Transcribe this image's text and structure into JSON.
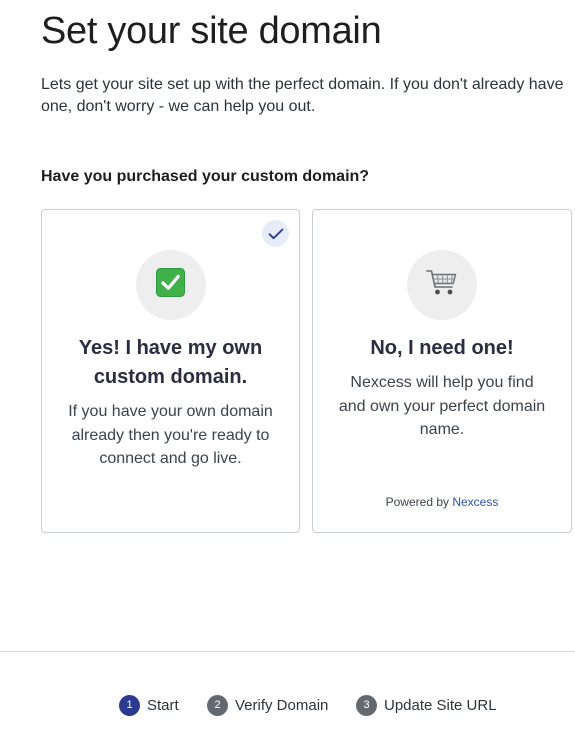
{
  "header": {
    "title": "Set your site domain",
    "intro": "Lets get your site set up with the perfect domain. If you don't already have one, don't worry - we can help you out."
  },
  "question": "Have you purchased your custom domain?",
  "options": [
    {
      "title": "Yes! I have my own custom domain.",
      "description": "If you have your own domain already then you're ready to connect and go live.",
      "icon": "checkmark-box-icon",
      "selected": true
    },
    {
      "title": "No, I need one!",
      "description": "Nexcess will help you find and own your perfect domain name.",
      "icon": "shopping-cart-icon",
      "powered_by_prefix": "Powered by",
      "powered_by_brand": "Nexcess"
    }
  ],
  "steps": [
    {
      "number": "1",
      "label": "Start",
      "active": true
    },
    {
      "number": "2",
      "label": "Verify Domain",
      "active": false
    },
    {
      "number": "3",
      "label": "Update Site URL",
      "active": false
    }
  ],
  "colors": {
    "step_active": "#2b3990",
    "step_inactive": "#646970",
    "selected_badge_bg": "#e5ebf7",
    "check_green": "#3fb04a",
    "brand_link": "#2c52a8"
  }
}
